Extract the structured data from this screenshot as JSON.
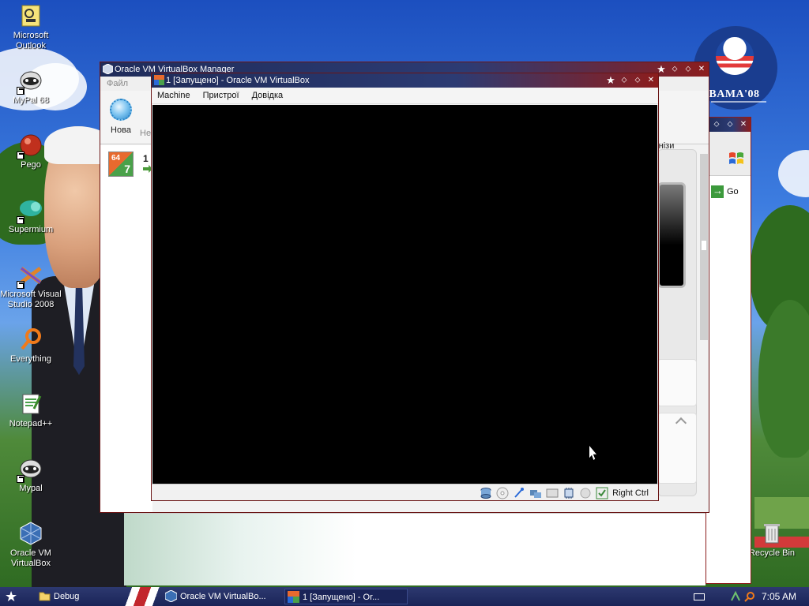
{
  "desktop": {
    "wallpaper_logo_text": "OBAMA'08",
    "icons": [
      {
        "label": "Microsoft Outlook",
        "icon": "outlook-icon"
      },
      {
        "label": "MyPal 68",
        "icon": "mypal-icon"
      },
      {
        "label": "Pego",
        "icon": "pego-icon"
      },
      {
        "label": "Supermium",
        "icon": "supermium-icon"
      },
      {
        "label": "Microsoft Visual Studio 2008",
        "icon": "visual-studio-icon"
      },
      {
        "label": "Everything",
        "icon": "everything-icon"
      },
      {
        "label": "Notepad++",
        "icon": "notepad-plus-plus-icon"
      },
      {
        "label": "Mypal",
        "icon": "mypal-icon"
      },
      {
        "label": "Oracle VM VirtualBox",
        "icon": "virtualbox-icon"
      },
      {
        "label": "Recycle Bin",
        "icon": "recycle-bin-icon"
      }
    ]
  },
  "manager_window": {
    "title": "Oracle VM VirtualBox Manager",
    "menu_faded": "Файл",
    "toolbar": {
      "new_label": "Нова",
      "second_label_partial": "Не",
      "snapshots_label": "Знізи"
    },
    "vm_list": [
      {
        "name": "1",
        "os_badge": "64",
        "os_num": "7"
      }
    ]
  },
  "vm_window": {
    "title": "1 [Запущено] - Oracle VM VirtualBox",
    "menu": [
      "Machine",
      "Пристрої",
      "Довідка"
    ],
    "statusbar": {
      "host_key": "Right Ctrl"
    }
  },
  "ie_window": {
    "go_label": "Go"
  },
  "taskbar": {
    "tasks": [
      {
        "label": "Debug",
        "icon": "folder-icon"
      },
      {
        "label": "Oracle VM VirtualBo...",
        "icon": "virtualbox-icon"
      },
      {
        "label": "1 [Запущено] - Or...",
        "icon": "vm-icon"
      }
    ],
    "clock": "7:05 AM"
  },
  "colors": {
    "title_navy": "#1f2c5a",
    "title_red": "#8c1d1d",
    "taskbar": "#1a2458",
    "vm_screen": "#000000"
  }
}
